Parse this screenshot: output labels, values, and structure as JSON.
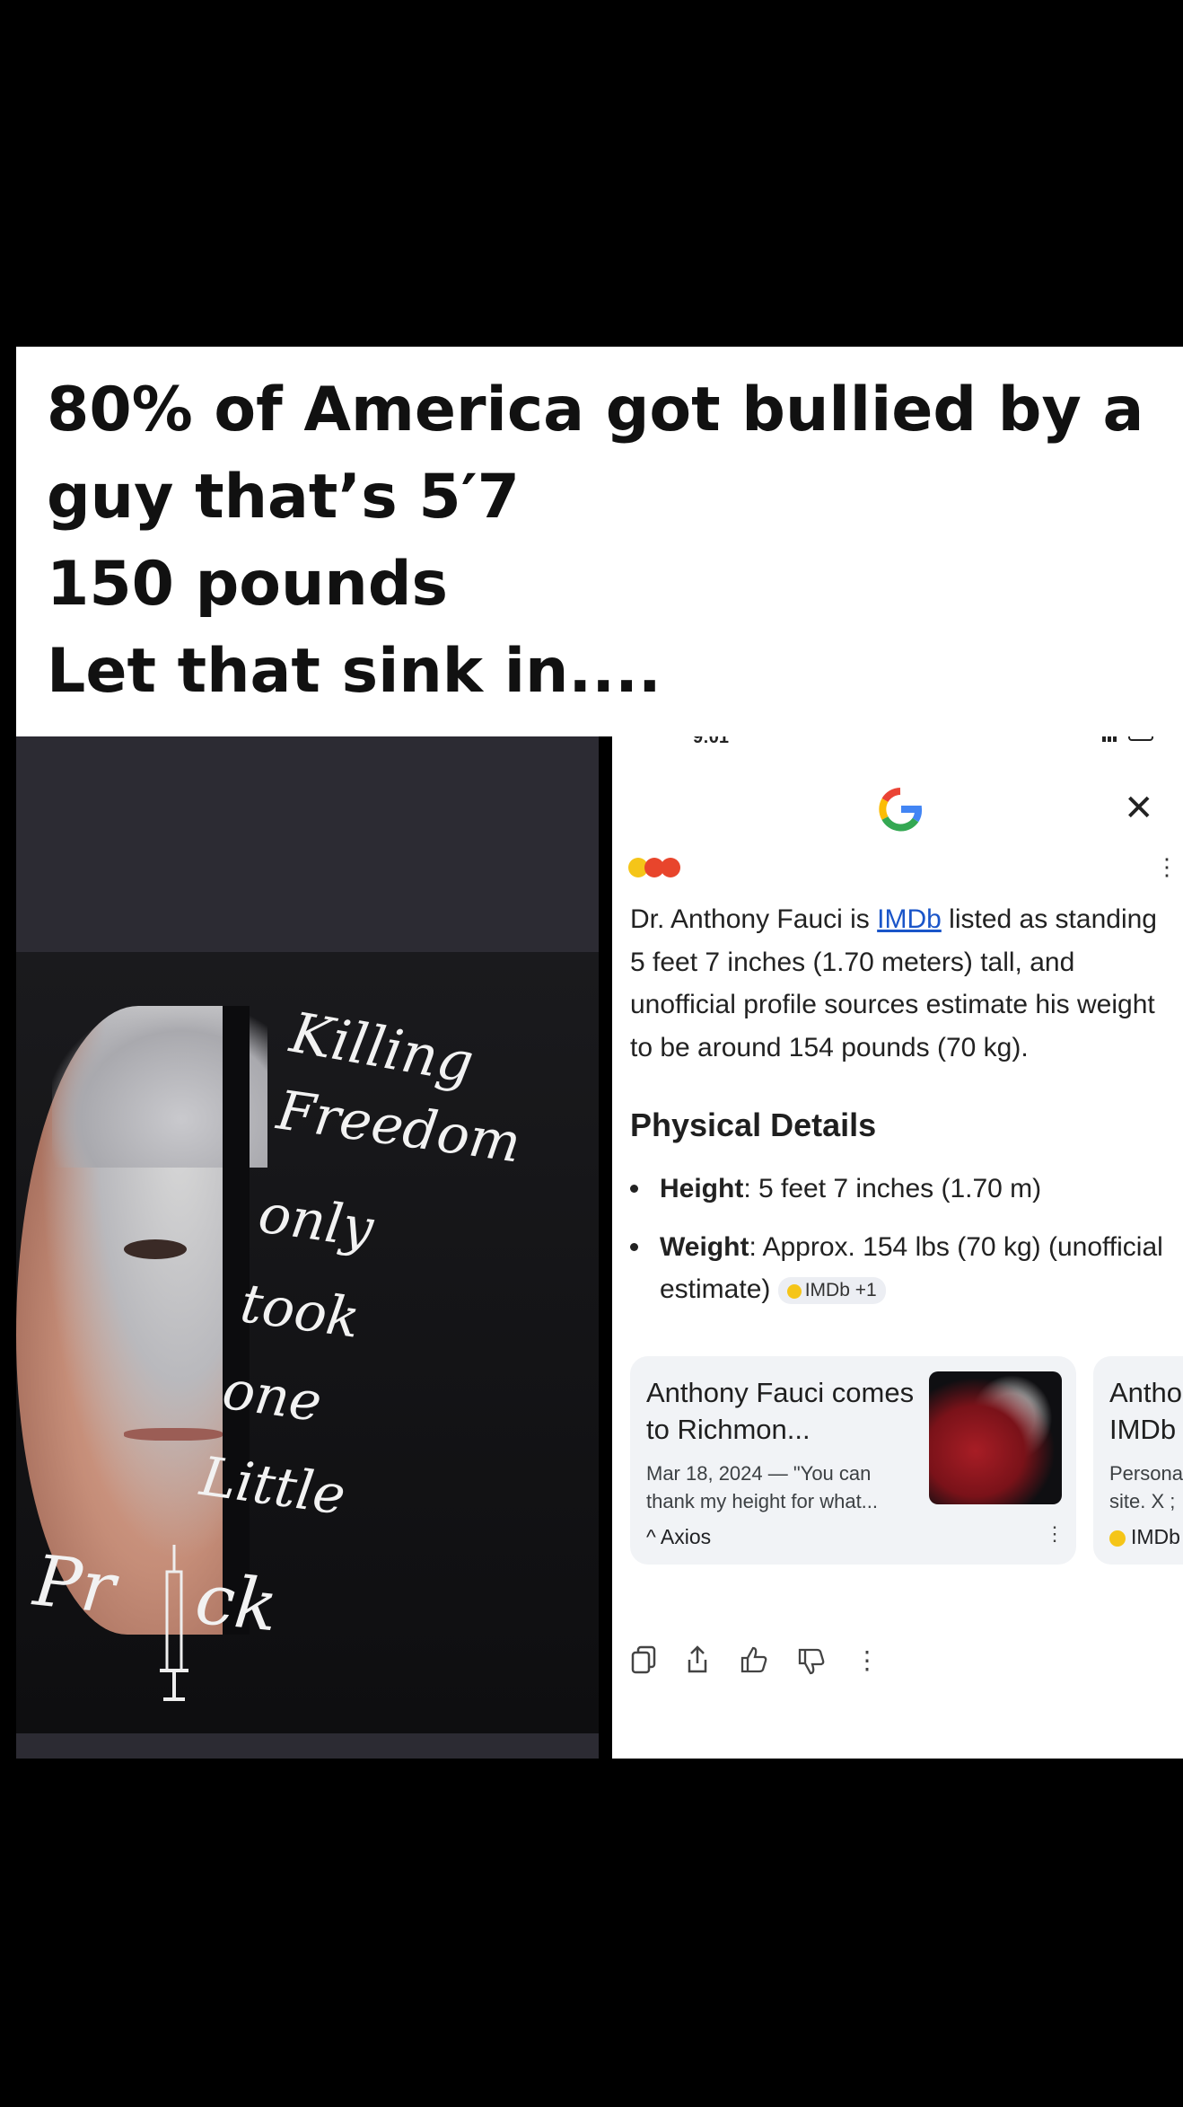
{
  "caption": {
    "lines": [
      "80% of America got bullied by a",
      "guy that’s 5′7",
      "150 pounds",
      "Let that sink in...."
    ]
  },
  "shirt": {
    "words": [
      "Killing",
      "Freedom",
      "only",
      "took",
      "one",
      "Little",
      "Pr",
      "ck"
    ]
  },
  "phone": {
    "status_time": "9:01",
    "logo": "G",
    "close_icon": "close-icon",
    "intro_pre": "Dr. Anthony Fauci is ",
    "intro_link": "IMDb",
    "intro_post": " listed as standing 5 feet 7 inches (1.70 meters) tall, and unofficial profile sources estimate his weight to be around 154 pounds (70 kg).",
    "section_title": "Physical Details",
    "bullets": [
      {
        "label": "Height",
        "text": ": 5 feet 7 inches (1.70 m)"
      },
      {
        "label": "Weight",
        "text": ": Approx. 154 lbs (70 kg) (unofficial estimate)",
        "chip": "IMDb +1"
      }
    ],
    "cards": [
      {
        "title": "Anthony Fauci comes to Richmon...",
        "snippet": "Mar 18, 2024 — \"You can thank my height for what...",
        "source": "Axios"
      },
      {
        "title": "Antho IMDb",
        "snippet": "Persona site. X ;",
        "source": "IMDb"
      }
    ],
    "actions": [
      "copy-icon",
      "share-icon",
      "thumbs-up-icon",
      "thumbs-down-icon",
      "more-icon"
    ]
  },
  "colors": {
    "link": "#1a55c9",
    "google_blue": "#4285f4",
    "card_bg": "#f1f3f6",
    "imdb_yellow": "#f5c518"
  }
}
